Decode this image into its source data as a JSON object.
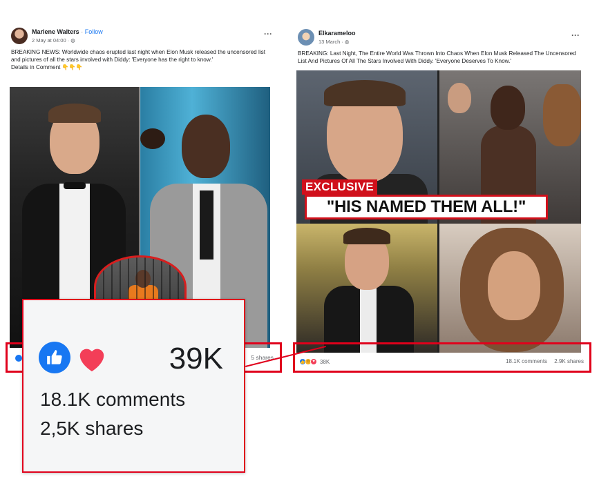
{
  "left_post": {
    "author": "Marlene Walters",
    "follow": "Follow",
    "separator": "·",
    "meta": "2 May at 04:00 ·",
    "text_main": "BREAKING NEWS: Worldwide chaos erupted last night when Elon Musk released the uncensored list and pictures of all the stars involved with Diddy: 'Everyone has the right to know.'",
    "text_details": "Details in Comment",
    "text_details_emoji": "👇👇👇",
    "shares_partial": "5 shares"
  },
  "right_post": {
    "author": "Elkarameloo",
    "meta": "13 March ·",
    "text_main": "BREAKING: Last Night, The Entire World Was Thrown Into Chaos When Elon Musk Released The Uncensored List And Pictures Of All The Stars Involved With Diddy. 'Everyone Deserves To Know.'",
    "exclusive_label": "EXCLUSIVE",
    "headline": "\"HIS NAMED THEM ALL!\"",
    "reaction_count": "38K",
    "comments": "18.1K comments",
    "shares": "2.9K shares"
  },
  "zoom_card": {
    "reaction_count": "39K",
    "comments": "18.1K comments",
    "shares": "2,5K shares"
  },
  "colors": {
    "facebook_blue": "#1877f2",
    "highlight_red": "#e0001b",
    "love_red": "#f33e58"
  },
  "icons": [
    "more-options-icon",
    "globe-icon",
    "like-reaction-icon",
    "love-reaction-icon",
    "haha-reaction-icon"
  ]
}
